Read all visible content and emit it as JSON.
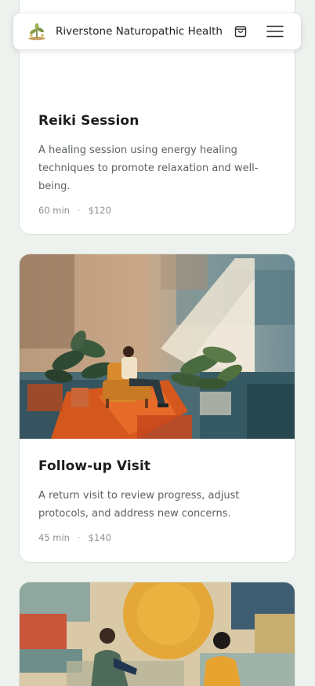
{
  "header": {
    "brand": "Riverstone Naturopathic Health",
    "logo_icon": "plant-logo-icon",
    "cart_icon": "shopping-bag-icon",
    "menu_icon": "hamburger-menu-icon"
  },
  "services": [
    {
      "title": "Reiki Session",
      "description": "A healing session using energy healing techniques to promote relaxation and well-being.",
      "duration": "60 min",
      "price": "$120"
    },
    {
      "title": "Follow-up Visit",
      "description": "A return visit to review progress, adjust protocols, and address new concerns.",
      "duration": "45 min",
      "price": "$140"
    }
  ],
  "meta_separator": "·",
  "colors": {
    "page_background": "#eef2ee",
    "card_border": "#d8e2d8",
    "text_primary": "#1b1d1b",
    "text_secondary": "#5c635d",
    "text_muted": "#8a918b"
  }
}
